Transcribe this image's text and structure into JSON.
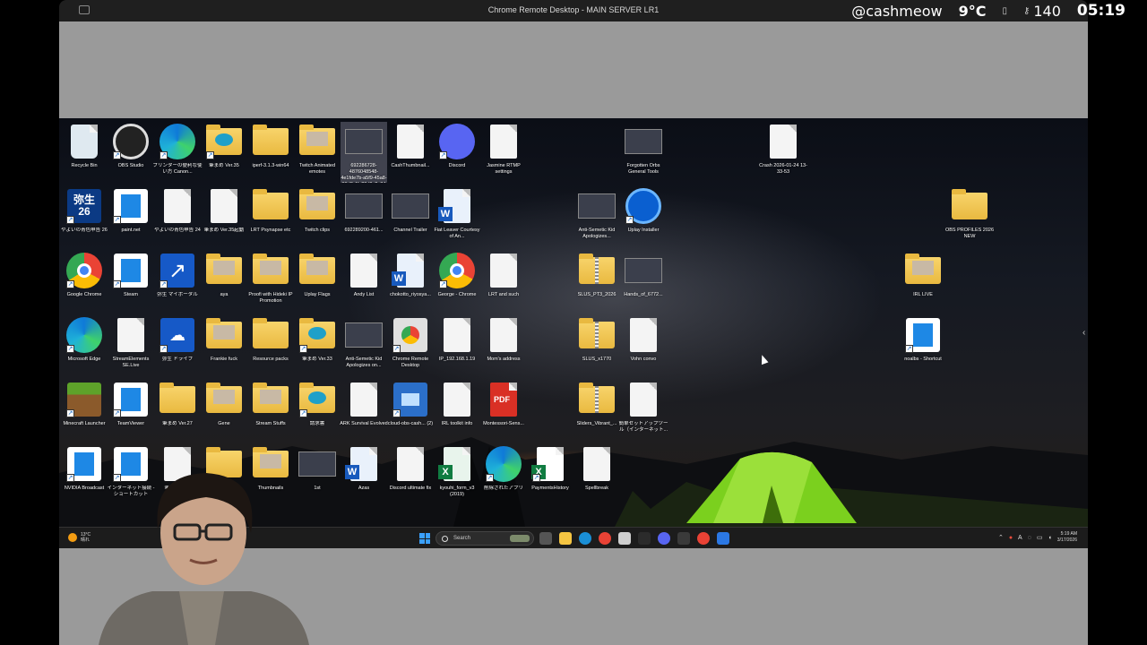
{
  "window": {
    "title": "Chrome Remote Desktop - MAIN SERVER LR1"
  },
  "overlay": {
    "handle": "@cashmeow",
    "temperature": "9°C",
    "viewers": "140",
    "time": "05:19",
    "icons": [
      "battery-icon",
      "key-icon"
    ]
  },
  "desktop": {
    "icons": [
      {
        "label": "Recycle Bin",
        "kind": "recycle"
      },
      {
        "label": "OBS Studio",
        "kind": "obs"
      },
      {
        "label": "プリンターの便利な使い方 Canon...",
        "kind": "edge"
      },
      {
        "label": "筆まめ Ver.35",
        "kind": "folder-edge"
      },
      {
        "label": "iperf-3.1.3-win64",
        "kind": "folder"
      },
      {
        "label": "Twitch Animated emotes",
        "kind": "folder-img"
      },
      {
        "label": "692286728-4876048548-4e1fde7b-a5f9-45a8-86d8-4fa20d0c2e84",
        "kind": "thumb"
      },
      {
        "label": "CashThumbnail...",
        "kind": "file"
      },
      {
        "label": "Discord",
        "kind": "discord"
      },
      {
        "label": "Jasmine RTMP settings",
        "kind": "file"
      },
      {
        "label": "Forgotten Orbs General Tools",
        "kind": "thumb"
      },
      {
        "label": "Crash 2026-01-24 13-33-53",
        "kind": "file"
      },
      {
        "label": "やよいの青色申告 26",
        "kind": "yayoi"
      },
      {
        "label": "paint.net",
        "kind": "app"
      },
      {
        "label": "やよいの青色申告 24",
        "kind": "file"
      },
      {
        "label": "筆まめ Ver.35起動",
        "kind": "file"
      },
      {
        "label": "LRT Psynapse etc",
        "kind": "folder"
      },
      {
        "label": "Twitch clips",
        "kind": "folder-img"
      },
      {
        "label": "692289200-461...",
        "kind": "thumb"
      },
      {
        "label": "Channel Trailer",
        "kind": "thumb"
      },
      {
        "label": "Fiat Leaver Courtesy of An...",
        "kind": "word"
      },
      {
        "label": "Anti-Semetic Kid Apologizes...",
        "kind": "thumb"
      },
      {
        "label": "Uplay Installer",
        "kind": "uplay"
      },
      {
        "label": "OBS PROFILES 2026 NEW",
        "kind": "folder"
      },
      {
        "label": "Google Chrome",
        "kind": "chrome"
      },
      {
        "label": "Steam",
        "kind": "app"
      },
      {
        "label": "弥生 マイポータル",
        "kind": "yayoi-arrow"
      },
      {
        "label": "aya",
        "kind": "folder-img"
      },
      {
        "label": "Proofi with Hideki IP Promotion",
        "kind": "folder-img"
      },
      {
        "label": "Uplay Flags",
        "kind": "folder-img"
      },
      {
        "label": "Andy List",
        "kind": "file"
      },
      {
        "label": "chokotto_riyosya...",
        "kind": "word"
      },
      {
        "label": "George - Chrome",
        "kind": "chrome"
      },
      {
        "label": "LRT and such",
        "kind": "file"
      },
      {
        "label": "SLUS_PT3_2026",
        "kind": "folder-zip"
      },
      {
        "label": "Hands_of_6772...",
        "kind": "thumb"
      },
      {
        "label": "IRL LIVE",
        "kind": "folder-img"
      },
      {
        "label": "Microsoft Edge",
        "kind": "edge"
      },
      {
        "label": "StreamElements SE.Live",
        "kind": "file"
      },
      {
        "label": "弥生 ドライブ",
        "kind": "yayoi-drive"
      },
      {
        "label": "Frankie fuck",
        "kind": "folder-img"
      },
      {
        "label": "Resource packs",
        "kind": "folder"
      },
      {
        "label": "筆まめ Ver.33",
        "kind": "folder-edge"
      },
      {
        "label": "Anti-Semetic Kid Apologizes on...",
        "kind": "thumb"
      },
      {
        "label": "Chrome Remote Desktop",
        "kind": "crd"
      },
      {
        "label": "IP_192.168.1.19",
        "kind": "file"
      },
      {
        "label": "Mom's address",
        "kind": "file"
      },
      {
        "label": "SLUS_x1770",
        "kind": "folder-zip"
      },
      {
        "label": "Vohn convo",
        "kind": "file"
      },
      {
        "label": "noalbs - Shortcut",
        "kind": "app"
      },
      {
        "label": "Minecraft Launcher",
        "kind": "minecraft"
      },
      {
        "label": "TeamViewer",
        "kind": "app"
      },
      {
        "label": "筆まめ Ver.27",
        "kind": "folder"
      },
      {
        "label": "Gene",
        "kind": "folder-img"
      },
      {
        "label": "Stream Stuffs",
        "kind": "folder-img"
      },
      {
        "label": "請求書",
        "kind": "folder-edge"
      },
      {
        "label": "ARK Survival Evolved",
        "kind": "file"
      },
      {
        "label": "cloud-obs-cash... (2)",
        "kind": "rdp"
      },
      {
        "label": "IRL toolkit info",
        "kind": "file"
      },
      {
        "label": "Montessori-Sens...",
        "kind": "pdf"
      },
      {
        "label": "Sliders_Vibrant_...",
        "kind": "folder-zip"
      },
      {
        "label": "簡単セットアップツール（インターネット...",
        "kind": "file"
      },
      {
        "label": "NVIDIA Broadcast",
        "kind": "app"
      },
      {
        "label": "インターネット接続 - ショートカット",
        "kind": "app"
      },
      {
        "label": "筆まめ Ve...",
        "kind": "file"
      },
      {
        "label": "",
        "kind": "folder"
      },
      {
        "label": "Thumbnails",
        "kind": "folder-img"
      },
      {
        "label": "1st",
        "kind": "thumb"
      },
      {
        "label": "Azas",
        "kind": "word"
      },
      {
        "label": "Discord ultimate fix",
        "kind": "file"
      },
      {
        "label": "kyouhi_form_v3 (2019)",
        "kind": "excel"
      },
      {
        "label": "削除されたアプリ",
        "kind": "edge"
      },
      {
        "label": "PaymentsHistory",
        "kind": "excel-a"
      },
      {
        "label": "Spellbreak",
        "kind": "file"
      }
    ]
  },
  "taskbar": {
    "weather_temp": "13°C",
    "weather_cond": "晴れ",
    "search_placeholder": "Search",
    "clock_time": "5:19 AM",
    "clock_date": "3/17/2026",
    "apps": [
      {
        "name": "task-view",
        "color": "#555555"
      },
      {
        "name": "file-explorer",
        "color": "#f5c542"
      },
      {
        "name": "edge",
        "color": "#1a8fd6"
      },
      {
        "name": "chrome",
        "color": "#e94235"
      },
      {
        "name": "app-generic",
        "color": "#cfcfcf"
      },
      {
        "name": "obs",
        "color": "#2b2b2b"
      },
      {
        "name": "discord",
        "color": "#5865f2"
      },
      {
        "name": "terminal",
        "color": "#3a3a3a"
      },
      {
        "name": "chrome-badge",
        "color": "#e94235"
      },
      {
        "name": "translator",
        "color": "#2b78e4"
      }
    ]
  }
}
